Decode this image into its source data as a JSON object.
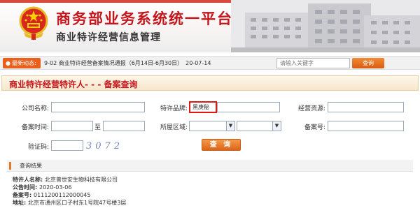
{
  "header": {
    "title": "商务部业务系统统一平台",
    "subtitle": "商业特许经营信息管理"
  },
  "news": {
    "badge": "最新动态:",
    "item_text": "9-02   商业特许经营备案情况通报（6月14日-6月30日）",
    "item_date": "20-07-14"
  },
  "search": {
    "placeholder": "请输入关键字",
    "button_label": "查询"
  },
  "panel": {
    "title": "商业特许经营特许人- - - 备案查询"
  },
  "form": {
    "company_label": "公司名称:",
    "company_value": "",
    "brand_label": "特许品牌:",
    "brand_value": "黑庚秘",
    "resource_label": "经营资源:",
    "resource_value": "",
    "record_time_label": "备案时间:",
    "to_label": "至",
    "region_label": "所屋区域:",
    "record_no_label": "备案号:",
    "captcha_label": "验证码:",
    "captcha_value": "3072",
    "query_button": "查 询"
  },
  "results": {
    "heading": "查询结果",
    "rows": [
      {
        "k": "特许人名称: ",
        "v": "北京普世安生物科技有限公司"
      },
      {
        "k": "公告时间: ",
        "v": "2020-03-06"
      },
      {
        "k": "备案号: ",
        "v": "0111200112000045"
      },
      {
        "k": "地址: ",
        "v": "北京市通州区口子村东1号院47号楼3层"
      }
    ]
  },
  "colors": {
    "brand_red": "#c4161c",
    "accent_orange": "#e8601c",
    "highlight_red": "#e01818"
  }
}
